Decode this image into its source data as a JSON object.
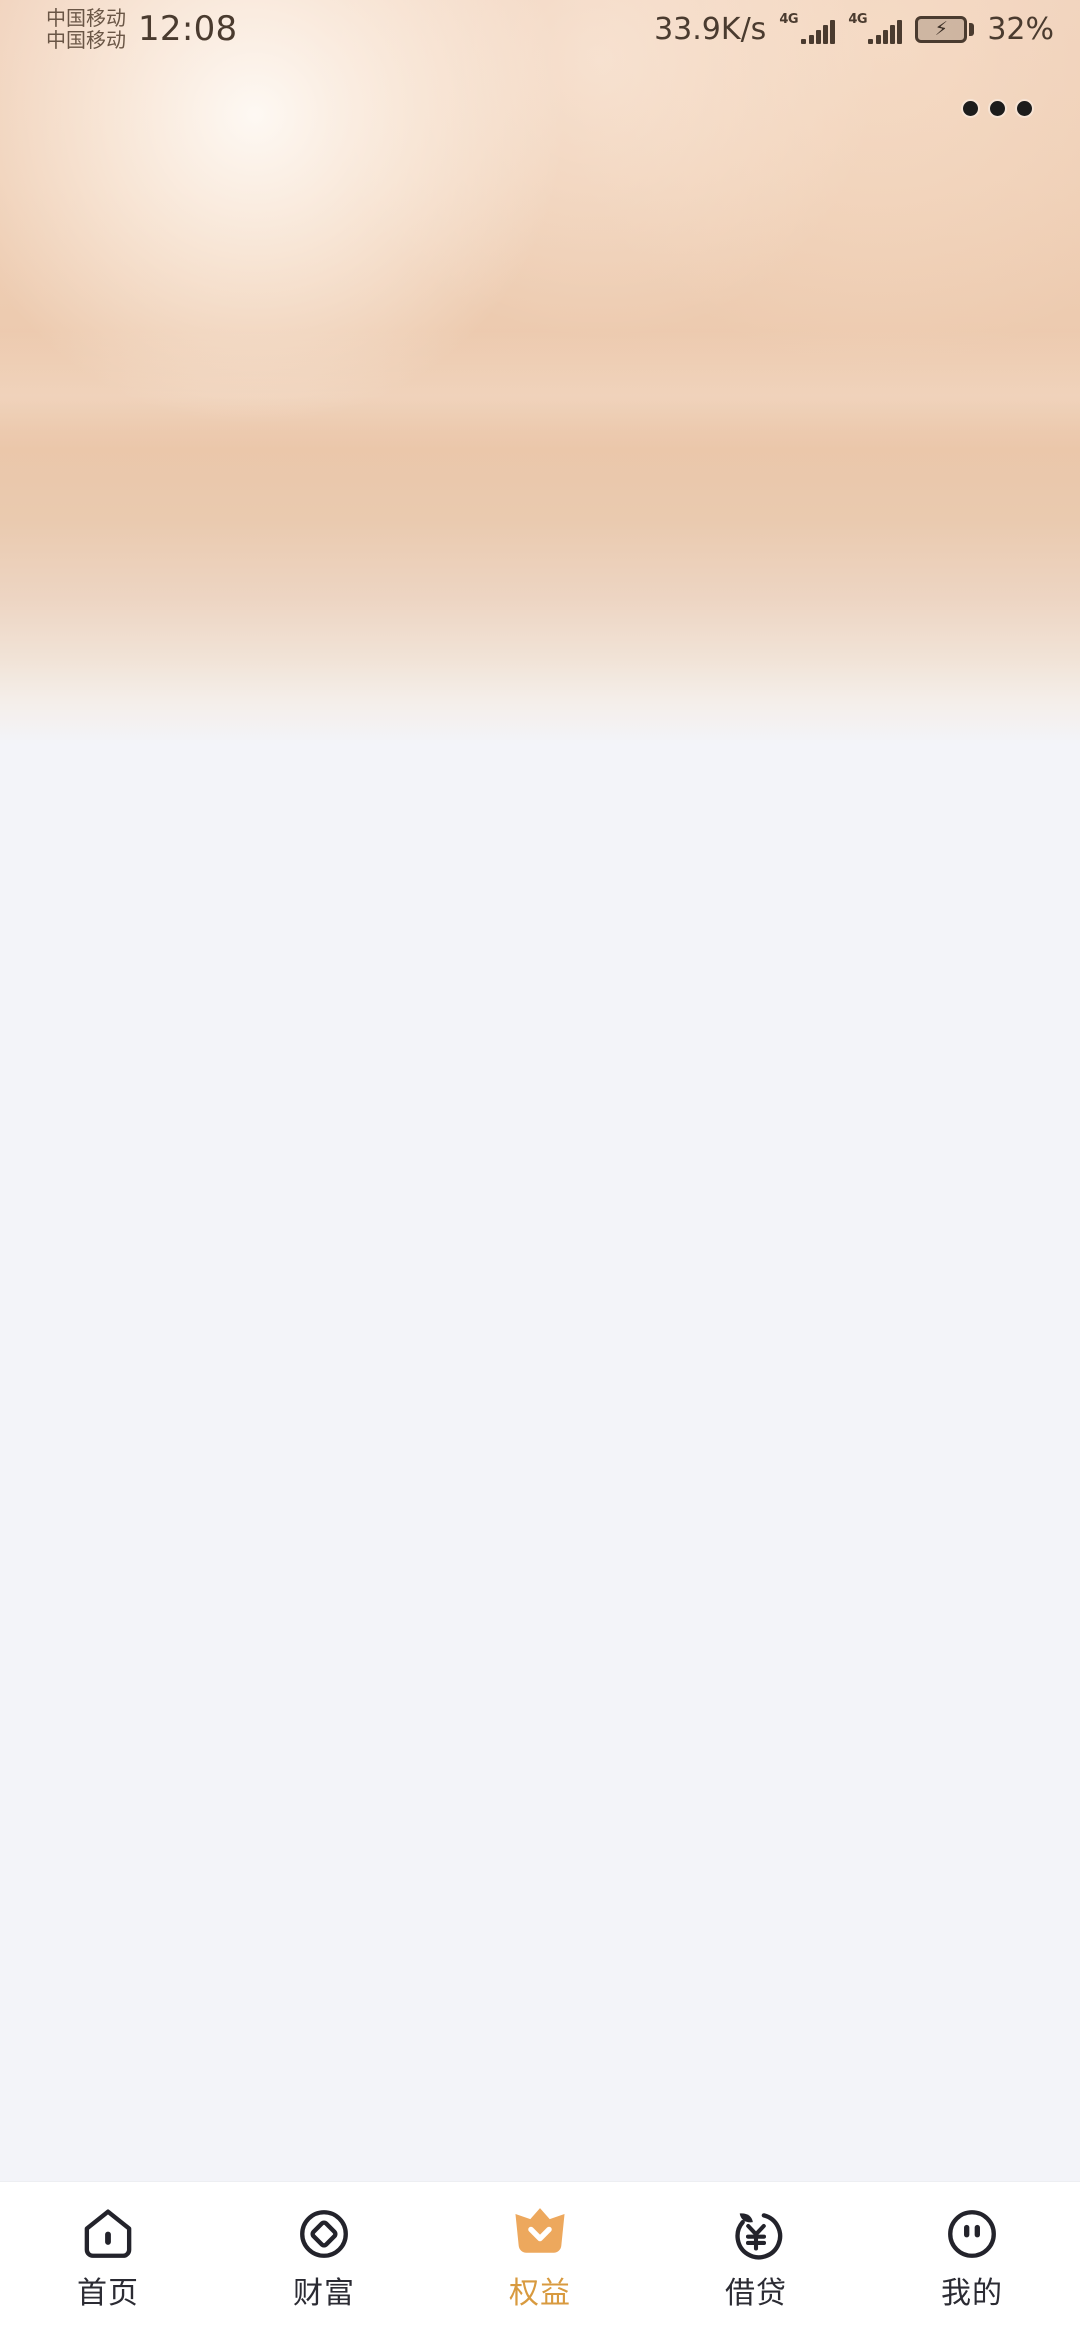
{
  "status_bar": {
    "carrier_primary": "中国移动",
    "carrier_secondary": "中国移动",
    "time": "12:08",
    "network_speed": "33.9K/s",
    "signal_1_label": "4G",
    "signal_2_label": "4G",
    "battery_percent": "32%",
    "battery_state_icon": "battery-charging-icon",
    "text_color": "#4A3B2F"
  },
  "top_bar": {
    "more_label": "更多",
    "more_icon": "more-horizontal-icon"
  },
  "header": {
    "background_top_color": "#F0D1BB",
    "background_mid_color": "#EBC6A9",
    "background_bottom_color": "#F3F4F9"
  },
  "content": {
    "state": "empty",
    "body_background": "#F3F4F9"
  },
  "tabbar": {
    "background": "#FFFFFF",
    "active_color": "#D89A3F",
    "inactive_color": "#2B2B33",
    "active_index": 2,
    "items": [
      {
        "label": "首页",
        "icon": "home-icon",
        "active": false
      },
      {
        "label": "财富",
        "icon": "coin-icon",
        "active": false
      },
      {
        "label": "权益",
        "icon": "crown-icon",
        "active": true
      },
      {
        "label": "借贷",
        "icon": "yuan-fruit-icon",
        "active": false
      },
      {
        "label": "我的",
        "icon": "face-icon",
        "active": false
      }
    ]
  }
}
